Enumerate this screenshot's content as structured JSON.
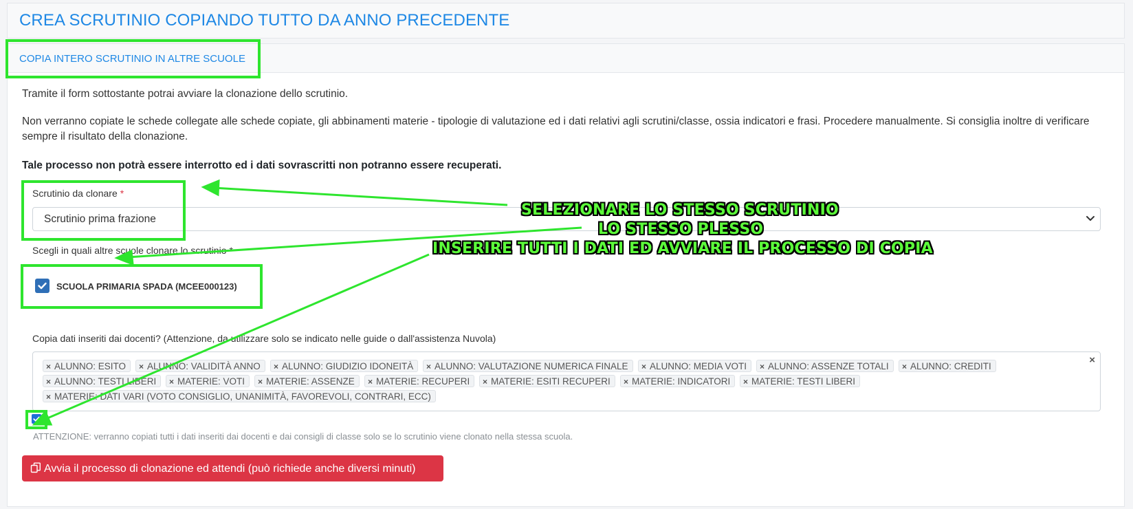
{
  "page": {
    "title": "CREA SCRUTINIO COPIANDO TUTTO DA ANNO PRECEDENTE"
  },
  "tab": {
    "label": "COPIA INTERO SCRUTINIO IN ALTRE SCUOLE"
  },
  "content": {
    "intro": "Tramite il form sottostante potrai avviare la clonazione dello scrutinio.",
    "warning": "Non verranno copiate le schede collegate alle schede copiate, gli abbinamenti materie - tipologie di valutazione ed i dati relativi agli scrutini/classe, ossia indicatori e frasi. Procedere manualmente. Si consiglia inoltre di verificare sempre il risultato della clonazione.",
    "notice": "Tale processo non potrà essere interrotto ed i dati sovrascritti non potranno essere recuperati."
  },
  "form": {
    "scrutinio_label": "Scrutinio da clonare",
    "required_mark": "*",
    "scrutinio_value": "Scrutinio prima frazione",
    "schools_label": "Scegli in quali altre scuole clonare lo scrutinio",
    "school_option": "SCUOLA PRIMARIA SPADA (MCEE000123)",
    "school_checked": true,
    "copy_label": "Copia dati inseriti dai docenti? (Attenzione, da utilizzare solo se indicato nelle guide o dall'assistenza Nuvola)",
    "tags": [
      "ALUNNO: ESITO",
      "ALUNNO: VALIDITÀ ANNO",
      "ALUNNO: GIUDIZIO IDONEITÀ",
      "ALUNNO: VALUTAZIONE NUMERICA FINALE",
      "ALUNNO: MEDIA VOTI",
      "ALUNNO: ASSENZE TOTALI",
      "ALUNNO: CREDITI",
      "ALUNNO: TESTI LIBERI",
      "MATERIE: VOTI",
      "MATERIE: ASSENZE",
      "MATERIE: RECUPERI",
      "MATERIE: ESITI RECUPERI",
      "MATERIE: INDICATORI",
      "MATERIE: TESTI LIBERI",
      "MATERIE: DATI VARI (VOTO CONSIGLIO, UNANIMITÀ, FAVOREVOLI, CONTRARI, ECC)"
    ],
    "tag_remove": "×",
    "clear_all": "×",
    "copy_checked": true,
    "help_text": "ATTENZIONE: verranno copiati tutti i dati inseriti dai docenti e dai consigli di classe solo se lo scrutinio viene clonato nella stessa scuola.",
    "submit_label": "Avvia il processo di clonazione ed attendi (può richiede anche diversi minuti)"
  },
  "annotation": {
    "line1": "SELEZIONARE LO STESSO SCRUTINIO",
    "line2": "LO STESSO PLESSO",
    "line3": "INSERIRE TUTTI I DATI ED AVVIARE IL PROCESSO DI COPIA",
    "color": "#2ee52e"
  },
  "colors": {
    "primary": "#1e88e5",
    "danger": "#dc3545",
    "checkbox": "#2f6fb7"
  }
}
